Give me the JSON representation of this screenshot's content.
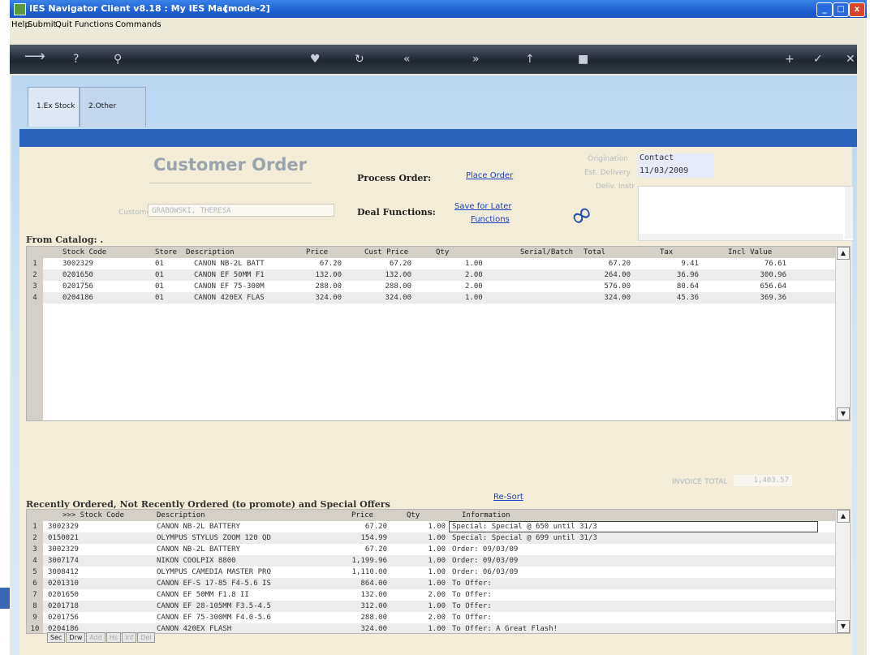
{
  "title": {
    "text": "IES Navigator Client v8.18 : My IES   Mac -",
    "mode": "[mode-2]"
  },
  "window_buttons": {
    "minimize": "_",
    "maximize": "□",
    "close": "x"
  },
  "menu": [
    "Help",
    "Submit",
    "Quit",
    "Functions",
    "Commands"
  ],
  "toolbar_icons": [
    "back-arrow-icon",
    "help-icon",
    "search-icon",
    "heart-icon",
    "refresh-icon",
    "rewind-icon",
    "forward-icon",
    "up-icon",
    "stop-icon",
    "plus-icon",
    "check-icon",
    "close-icon"
  ],
  "tabs": [
    {
      "label": "1.Ex Stock"
    },
    {
      "label": "2.Other"
    }
  ],
  "form": {
    "title": "Customer Order",
    "customer_label": "Customer",
    "customer_value": "GRABOWSKI, THERESA",
    "process_order_label": "Process Order:",
    "place_order_link": "Place Order",
    "deal_functions_label": "Deal Functions:",
    "save_for_later_link": "Save for Later",
    "functions_link": "Functions",
    "origination_label": "Origination",
    "origination_value": "Contact",
    "est_delivery_label": "Est. Delivery",
    "est_delivery_value": "11/03/2009",
    "deliv_instr_label": "Deliv. Instr"
  },
  "catalog": {
    "title": "From Catalog: .",
    "columns": [
      "Stock Code",
      "Store",
      "Description",
      "Price",
      "Cust Price",
      "Qty",
      "Serial/Batch",
      "Total",
      "Tax",
      "Incl Value"
    ],
    "rows": [
      {
        "n": "1",
        "code": "3002329",
        "store": "01",
        "desc": "CANON NB-2L BATT",
        "price": "67.20",
        "cust": "67.20",
        "qty": "1.00",
        "total": "67.20",
        "tax": "9.41",
        "incl": "76.61"
      },
      {
        "n": "2",
        "code": "0201650",
        "store": "01",
        "desc": "CANON EF 50MM F1",
        "price": "132.00",
        "cust": "132.00",
        "qty": "2.00",
        "total": "264.00",
        "tax": "36.96",
        "incl": "300.96"
      },
      {
        "n": "3",
        "code": "0201756",
        "store": "01",
        "desc": "CANON EF 75-300M",
        "price": "288.00",
        "cust": "288.00",
        "qty": "2.00",
        "total": "576.00",
        "tax": "80.64",
        "incl": "656.64"
      },
      {
        "n": "4",
        "code": "0204186",
        "store": "01",
        "desc": "CANON 420EX FLAS",
        "price": "324.00",
        "cust": "324.00",
        "qty": "1.00",
        "total": "324.00",
        "tax": "45.36",
        "incl": "369.36"
      }
    ],
    "invoice_total_label": "INVOICE TOTAL",
    "invoice_total_value": "1,403.57"
  },
  "recent": {
    "title": "Recently Ordered, Not Recently Ordered (to promote) and Special Offers",
    "resort_link": "Re-Sort",
    "columns": [
      ">>> Stock Code",
      "Description",
      "Price",
      "Qty",
      "Information"
    ],
    "rows": [
      {
        "n": "1",
        "code": "3002329",
        "desc": "CANON NB-2L BATTERY",
        "price": "67.20",
        "qty": "1.00",
        "info": "Special: Special @ 650 until 31/3"
      },
      {
        "n": "2",
        "code": "0150021",
        "desc": "OLYMPUS STYLUS ZOOM 120 QD",
        "price": "154.99",
        "qty": "1.00",
        "info": "Special: Special @ 699 until 31/3"
      },
      {
        "n": "3",
        "code": "3002329",
        "desc": "CANON NB-2L BATTERY",
        "price": "67.20",
        "qty": "1.00",
        "info": "Order: 09/03/09"
      },
      {
        "n": "4",
        "code": "3007174",
        "desc": "NIKON COOLPIX 8800",
        "price": "1,199.96",
        "qty": "1.00",
        "info": "Order: 09/03/09"
      },
      {
        "n": "5",
        "code": "3008412",
        "desc": "OLYMPUS CAMEDIA MASTER PRO",
        "price": "1,110.00",
        "qty": "1.00",
        "info": "Order: 06/03/09"
      },
      {
        "n": "6",
        "code": "0201310",
        "desc": "CANON EF-S 17-85 F4-5.6 IS",
        "price": "864.00",
        "qty": "1.00",
        "info": "To Offer:"
      },
      {
        "n": "7",
        "code": "0201650",
        "desc": "CANON EF 50MM F1.8 II",
        "price": "132.00",
        "qty": "2.00",
        "info": "To Offer:"
      },
      {
        "n": "8",
        "code": "0201718",
        "desc": "CANON EF 28-105MM F3.5-4.5",
        "price": "312.00",
        "qty": "1.00",
        "info": "To Offer:"
      },
      {
        "n": "9",
        "code": "0201756",
        "desc": "CANON EF 75-300MM F4.0-5.6",
        "price": "288.00",
        "qty": "2.00",
        "info": "To Offer:"
      },
      {
        "n": "10",
        "code": "0204186",
        "desc": "CANON 420EX FLASH",
        "price": "324.00",
        "qty": "1.00",
        "info": "To Offer: A Great Flash!"
      }
    ]
  },
  "bottom_tabs": [
    "Sec",
    "Drw",
    "Add",
    "Hs",
    "Inf",
    "Del"
  ],
  "colors": {
    "title_bar": "#1f5fd0",
    "blue_bar": "#2c64bd",
    "link": "#1a3fc0",
    "form_bg": "#f2ecd9"
  }
}
